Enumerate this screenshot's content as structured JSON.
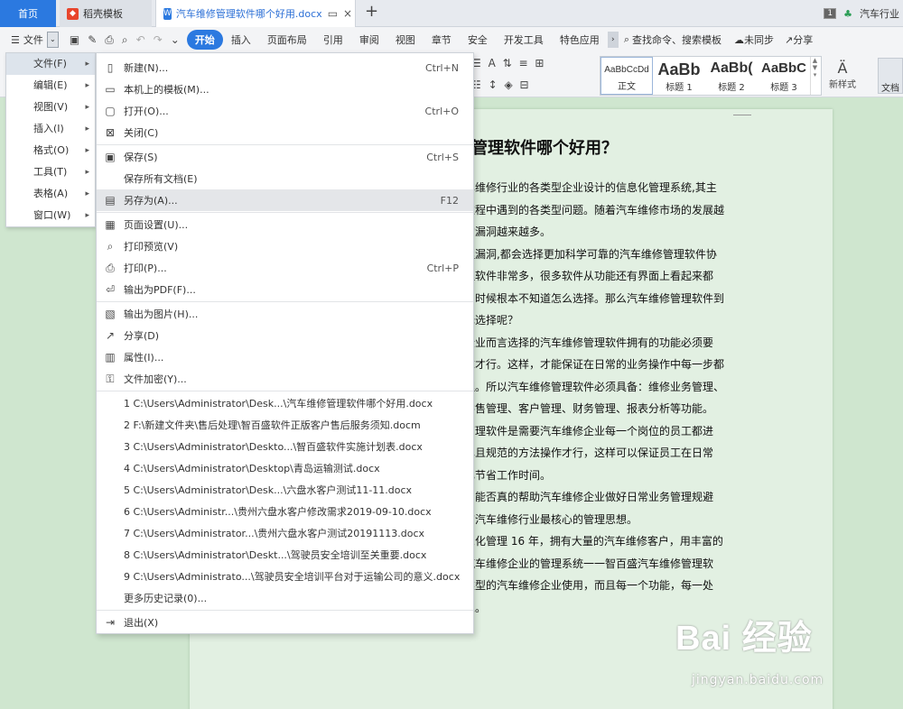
{
  "tabs": {
    "home": "首页",
    "template": "稻壳模板",
    "doc": "汽车维修管理软件哪个好用.docx",
    "add": "+",
    "right_badge": "1",
    "right_label": "汽车行业"
  },
  "menubar": {
    "file": "文件",
    "tabs": [
      "开始",
      "插入",
      "页面布局",
      "引用",
      "审阅",
      "视图",
      "章节",
      "安全",
      "开发工具",
      "特色应用"
    ],
    "search": "查找命令、搜索模板",
    "sync": "未同步",
    "share": "分享"
  },
  "toolbar": {
    "styles": [
      {
        "sample": "AaBbCcDd",
        "label": "正文"
      },
      {
        "sample": "AaBb",
        "label": "标题 1"
      },
      {
        "sample": "AaBb(",
        "label": "标题 2"
      },
      {
        "sample": "AaBbC",
        "label": "标题 3"
      }
    ],
    "new_style": "新样式",
    "doc_mode": "文档"
  },
  "left_menu": {
    "items": [
      "文件(F)",
      "编辑(E)",
      "视图(V)",
      "插入(I)",
      "格式(O)",
      "工具(T)",
      "表格(A)",
      "窗口(W)"
    ]
  },
  "file_menu": {
    "items": [
      {
        "label": "新建(N)...",
        "shortcut": "Ctrl+N",
        "icon": "new-doc-icon"
      },
      {
        "label": "本机上的模板(M)...",
        "shortcut": "",
        "icon": "template-icon"
      },
      {
        "label": "打开(O)...",
        "shortcut": "Ctrl+O",
        "icon": "open-icon"
      },
      {
        "label": "关闭(C)",
        "shortcut": "",
        "icon": "close-doc-icon"
      },
      {
        "label": "保存(S)",
        "shortcut": "Ctrl+S",
        "icon": "save-icon"
      },
      {
        "label": "保存所有文档(E)",
        "shortcut": "",
        "icon": ""
      },
      {
        "label": "另存为(A)...",
        "shortcut": "F12",
        "icon": "save-as-icon"
      },
      {
        "label": "页面设置(U)...",
        "shortcut": "",
        "icon": "page-setup-icon"
      },
      {
        "label": "打印预览(V)",
        "shortcut": "",
        "icon": "print-preview-icon"
      },
      {
        "label": "打印(P)...",
        "shortcut": "Ctrl+P",
        "icon": "print-icon"
      },
      {
        "label": "输出为PDF(F)...",
        "shortcut": "",
        "icon": "pdf-icon"
      },
      {
        "label": "输出为图片(H)...",
        "shortcut": "",
        "icon": "image-export-icon"
      },
      {
        "label": "分享(D)",
        "shortcut": "",
        "icon": "share-icon"
      },
      {
        "label": "属性(I)...",
        "shortcut": "",
        "icon": "properties-icon"
      },
      {
        "label": "文件加密(Y)...",
        "shortcut": "",
        "icon": "encrypt-icon"
      }
    ],
    "recent": [
      "1 C:\\Users\\Administrator\\Desk...\\汽车维修管理软件哪个好用.docx",
      "2 F:\\新建文件夹\\售后处理\\智百盛软件正版客户售后服务须知.docm",
      "3 C:\\Users\\Administrator\\Deskto...\\智百盛软件实施计划表.docx",
      "4 C:\\Users\\Administrator\\Desktop\\青岛运输测试.docx",
      "5 C:\\Users\\Administrator\\Desk...\\六盘水客户测试11-11.docx",
      "6 C:\\Users\\Administr...\\贵州六盘水客户修改需求2019-09-10.docx",
      "7 C:\\Users\\Administrator...\\贵州六盘水客户测试20191113.docx",
      "8 C:\\Users\\Administrator\\Deskt...\\驾驶员安全培训至关重要.docx",
      "9 C:\\Users\\Administrato...\\驾驶员安全培训平台对于运输公司的意义.docx"
    ],
    "more_history": "更多历史记录(0)...",
    "exit": "退出(X)"
  },
  "document": {
    "title": "管理软件哪个好用？",
    "lines": [
      "车维修行业的各类型企业设计的信息化管理系统,其主",
      "过程中遇到的各类型问题。随着汽车维修市场的发展越",
      "的漏洞越来越多。",
      "理漏洞,都会选择更加科学可靠的汽车维修管理软件协",
      "理软件非常多，很多软件从功能还有界面上看起来都",
      "叫时候根本不知道怎么选择。那么汽车维修管理软件到",
      "择选择呢？",
      "企业而言选择的汽车维修管理软件拥有的功能必须要",
      "求才行。这样，才能保证在日常的业务操作中每一步都",
      "理。所以汽车维修管理软件必须具备：维修业务管理、",
      "零售管理、客户管理、财务管理、报表分析等功能。",
      "管理软件是需要汽车维修企业每一个岗位的员工都进",
      "单且规范的方法操作才行，这样可以保证员工在日常",
      "已节省工作时间。",
      "，能否真的帮助汽车维修企业做好日常业务管理规避",
      "有汽车维修行业最核心的管理思想。",
      "息化管理 16 年，拥有大量的汽车维修客户，用丰富的",
      "汽车维修企业的管理系统一一智百盛汽车维修管理软",
      "类型的汽车维修企业使用，而且每一个功能，每一处",
      "思。"
    ]
  },
  "watermark": {
    "logo": "Bai 经验",
    "url": "jingyan.baidu.com"
  },
  "colors": {
    "accent": "#2b79e0",
    "workspace": "#cfe6cf",
    "page": "#e2f0e2"
  }
}
